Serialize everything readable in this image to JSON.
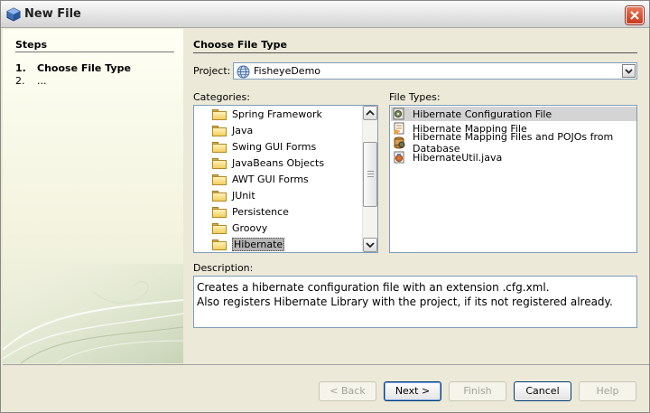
{
  "window": {
    "title": "New File"
  },
  "steps": {
    "heading": "Steps",
    "items": [
      {
        "number": "1.",
        "label": "Choose File Type"
      },
      {
        "number": "2.",
        "label": "..."
      }
    ]
  },
  "main": {
    "heading": "Choose File Type",
    "project_label": "Project:",
    "project_value": "FisheyeDemo",
    "categories_label": "Categories:",
    "file_types_label": "File Types:",
    "description_label": "Description:"
  },
  "categories": [
    "Spring Framework",
    "Java",
    "Swing GUI Forms",
    "JavaBeans Objects",
    "AWT GUI Forms",
    "JUnit",
    "Persistence",
    "Groovy",
    "Hibernate"
  ],
  "selected_category": "Hibernate",
  "file_types": [
    {
      "label": "Hibernate Configuration File",
      "icon": "hibernate-config-icon"
    },
    {
      "label": "Hibernate Mapping File",
      "icon": "hibernate-mapping-icon"
    },
    {
      "label": "Hibernate Mapping Files and POJOs from Database",
      "icon": "hibernate-db-icon"
    },
    {
      "label": "HibernateUtil.java",
      "icon": "java-class-icon"
    }
  ],
  "selected_file_type": "Hibernate Configuration File",
  "description": {
    "line1": "Creates a hibernate configuration file with an extension .cfg.xml.",
    "line2": "Also registers Hibernate Library with the project, if its not registered already."
  },
  "buttons": {
    "back": "< Back",
    "next": "Next >",
    "finish": "Finish",
    "cancel": "Cancel",
    "help": "Help"
  }
}
